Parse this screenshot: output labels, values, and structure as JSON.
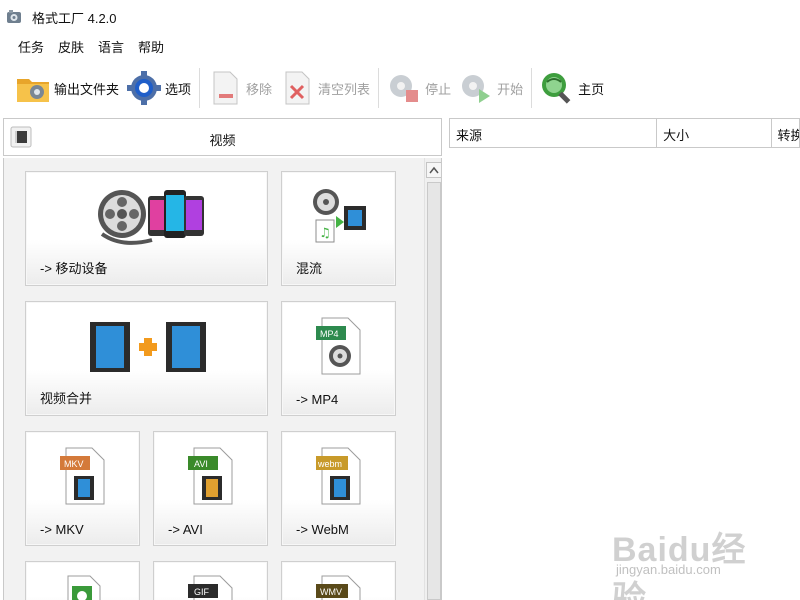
{
  "window": {
    "title": "格式工厂 4.2.0"
  },
  "menu": [
    "任务",
    "皮肤",
    "语言",
    "帮助"
  ],
  "toolbar": {
    "output_folder": "输出文件夹",
    "options": "选项",
    "remove": "移除",
    "clear_list": "清空列表",
    "stop": "停止",
    "start": "开始",
    "home": "主页"
  },
  "left_header": {
    "title": "视频"
  },
  "tiles": {
    "mobile": "-> 移动设备",
    "mux": "混流",
    "video_join": "视频合并",
    "mp4": "-> MP4",
    "mkv": "-> MKV",
    "avi": "-> AVI",
    "webm": "-> WebM"
  },
  "badges": {
    "mp4": "MP4",
    "mkv": "MKV",
    "avi": "AVI",
    "webm": "webm",
    "gif": "GIF",
    "wmv": "WMV"
  },
  "table": {
    "columns": [
      "来源",
      "大小",
      "转换"
    ]
  },
  "watermark": {
    "brand": "Baidu经验",
    "url": "jingyan.baidu.com"
  }
}
